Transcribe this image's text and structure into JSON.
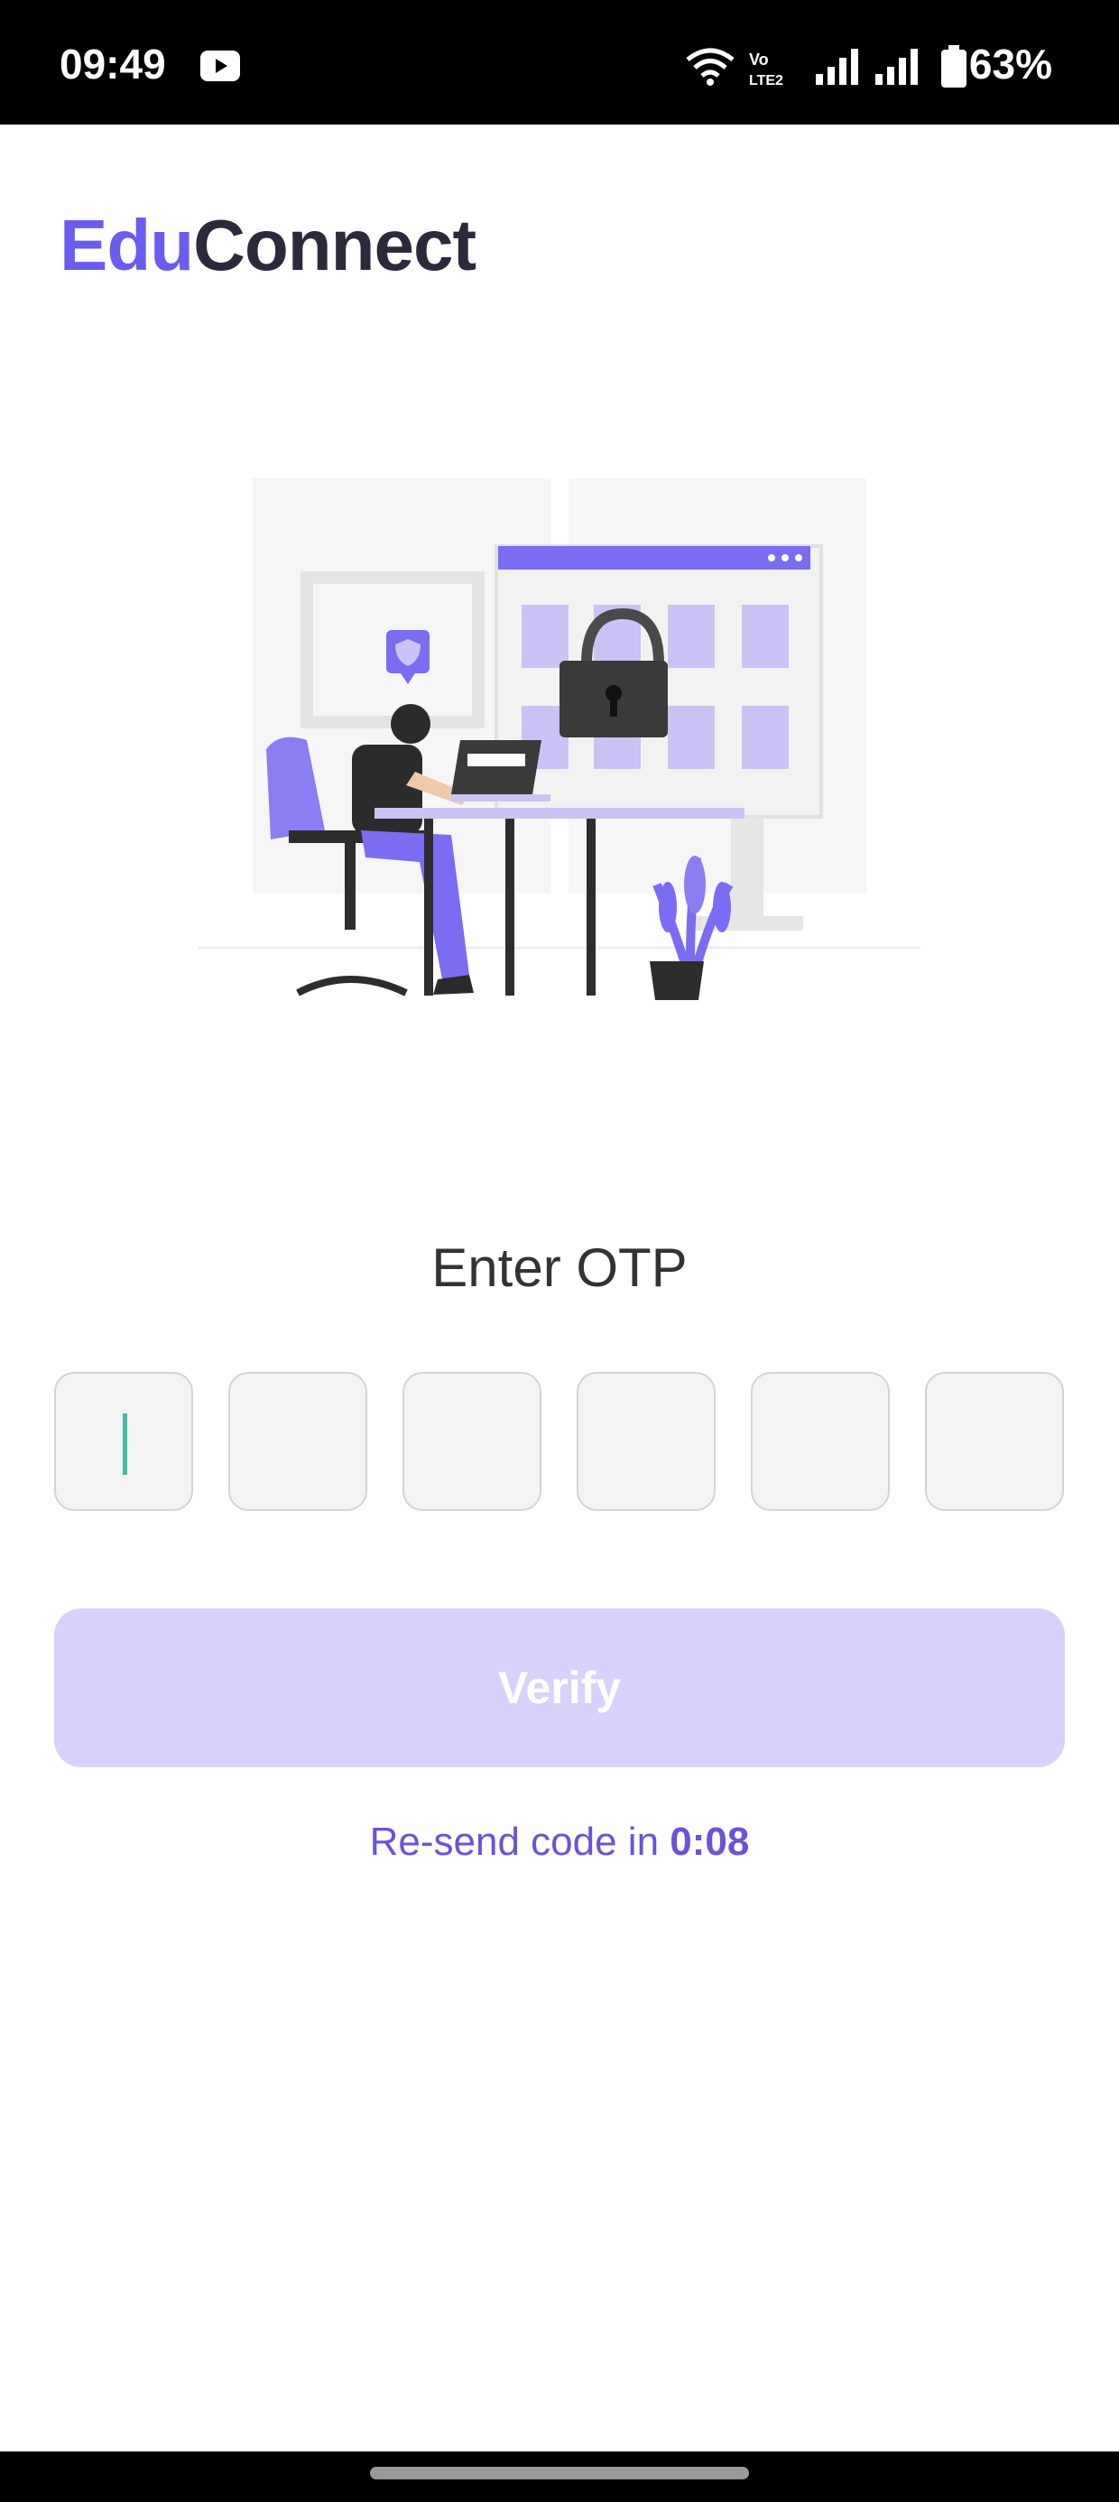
{
  "status_bar": {
    "time": "09:49",
    "battery": "63%",
    "icons": [
      "youtube-icon",
      "wifi-icon",
      "volte-icon",
      "signal-icon",
      "signal-icon",
      "battery-icon"
    ]
  },
  "brand": {
    "logo_part1": "Edu",
    "logo_part2": "Connect",
    "accent_color": "#6b5cf0",
    "dark_color": "#2c2a3a"
  },
  "otp": {
    "title": "Enter OTP",
    "digits": [
      "",
      "",
      "",
      "",
      "",
      ""
    ],
    "focused_index": 0
  },
  "verify_button": {
    "label": "Verify",
    "disabled": true,
    "color": "#d6d2fb"
  },
  "resend": {
    "prefix": "Re-send code in ",
    "timer": "0:08",
    "color": "#6b52d9"
  }
}
